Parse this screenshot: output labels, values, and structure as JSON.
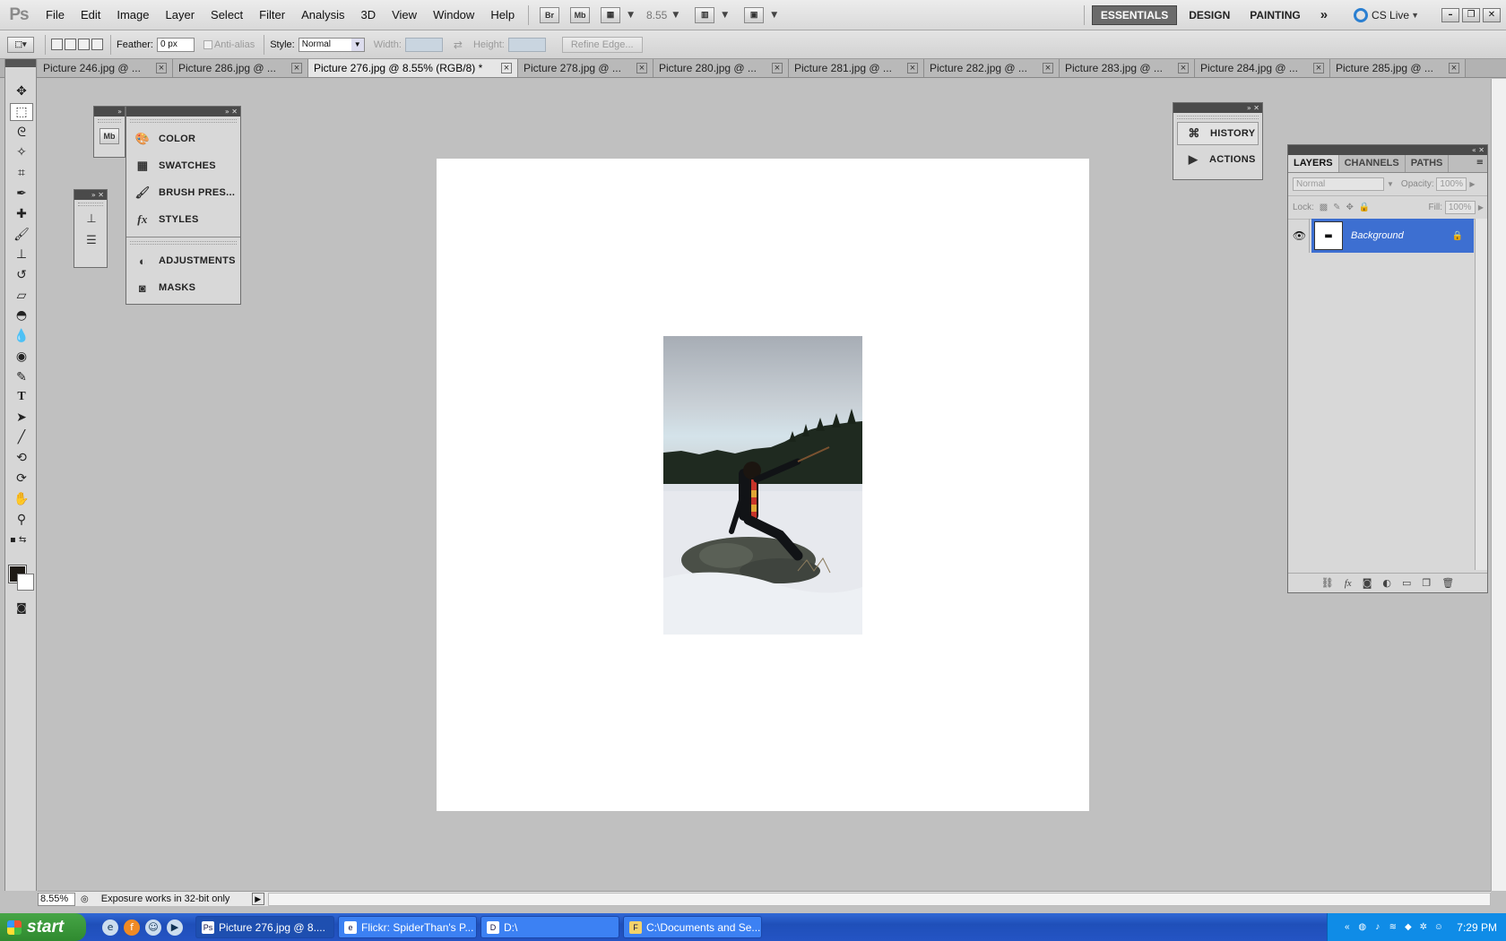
{
  "app": {
    "logo": "Ps"
  },
  "menu": [
    "File",
    "Edit",
    "Image",
    "Layer",
    "Select",
    "Filter",
    "Analysis",
    "3D",
    "View",
    "Window",
    "Help"
  ],
  "appbar": {
    "bridge_label": "Br",
    "minibridge_label": "Mb",
    "zoom": "8.55",
    "workspaces": [
      "ESSENTIALS",
      "DESIGN",
      "PAINTING"
    ],
    "active_workspace": "ESSENTIALS",
    "more_label": "»",
    "cslive_label": "CS Live"
  },
  "options": {
    "feather_label": "Feather:",
    "feather_value": "0 px",
    "antialias_label": "Anti-alias",
    "style_label": "Style:",
    "style_value": "Normal",
    "width_label": "Width:",
    "height_label": "Height:",
    "refine_edge_label": "Refine Edge..."
  },
  "tabs": [
    {
      "label": "Picture 246.jpg @ ...",
      "active": false
    },
    {
      "label": "Picture 286.jpg @ ...",
      "active": false
    },
    {
      "label": "Picture 276.jpg @ 8.55% (RGB/8) *",
      "active": true
    },
    {
      "label": "Picture 278.jpg @ ...",
      "active": false
    },
    {
      "label": "Picture 280.jpg @ ...",
      "active": false
    },
    {
      "label": "Picture 281.jpg @ ...",
      "active": false
    },
    {
      "label": "Picture 282.jpg @ ...",
      "active": false
    },
    {
      "label": "Picture 283.jpg @ ...",
      "active": false
    },
    {
      "label": "Picture 284.jpg @ ...",
      "active": false
    },
    {
      "label": "Picture 285.jpg @ ...",
      "active": false
    }
  ],
  "panels": {
    "dock_left": [
      "COLOR",
      "SWATCHES",
      "BRUSH PRES...",
      "STYLES"
    ],
    "dock_left_lower": [
      "ADJUSTMENTS",
      "MASKS"
    ],
    "minibridge_icon_label": "Mb",
    "history_actions": [
      "HISTORY",
      "ACTIONS"
    ]
  },
  "layers": {
    "tabs": [
      "LAYERS",
      "CHANNELS",
      "PATHS"
    ],
    "blend_mode": "Normal",
    "opacity_label": "Opacity:",
    "opacity_value": "100%",
    "lock_label": "Lock:",
    "fill_label": "Fill:",
    "fill_value": "100%",
    "items": [
      {
        "name": "Background",
        "locked": true,
        "visible": true
      }
    ]
  },
  "status": {
    "zoom": "8.55%",
    "info": "Exposure works in 32-bit only"
  },
  "taskbar": {
    "start_label": "start",
    "buttons": [
      {
        "label": "Picture 276.jpg @ 8....",
        "icon": "Ps",
        "active": true
      },
      {
        "label": "Flickr: SpiderThan's P...",
        "icon": "e",
        "active": false
      },
      {
        "label": "D:\\",
        "icon": "D",
        "active": false
      },
      {
        "label": "C:\\Documents and Se...",
        "icon": "F",
        "active": false
      }
    ],
    "clock": "7:29 PM"
  },
  "colors": {
    "foreground": "#1e1a15",
    "background": "#ffffff",
    "layer_highlight": "#3d6fd1"
  }
}
